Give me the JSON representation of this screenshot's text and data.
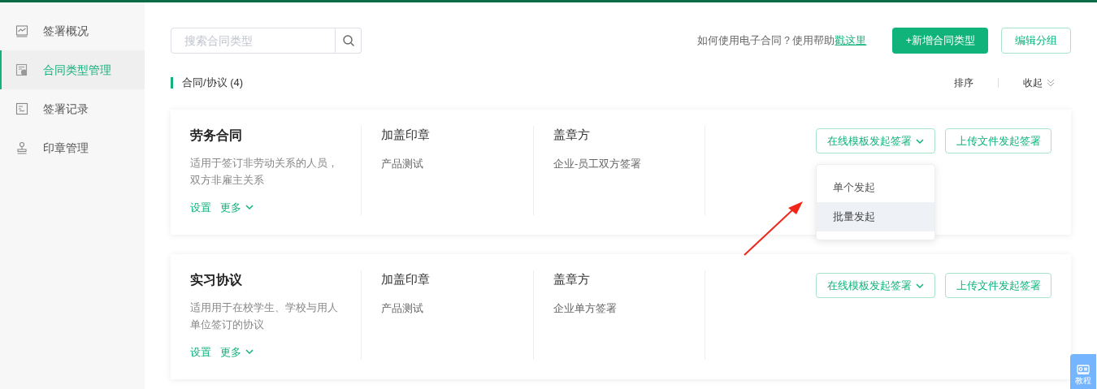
{
  "sidebar": {
    "items": [
      {
        "label": "签署概况",
        "selected": false
      },
      {
        "label": "合同类型管理",
        "selected": true
      },
      {
        "label": "签署记录",
        "selected": false
      },
      {
        "label": "印章管理",
        "selected": false
      }
    ]
  },
  "search": {
    "placeholder": "搜索合同类型"
  },
  "help": {
    "text": "如何使用电子合同？使用帮助",
    "link": "戳这里"
  },
  "buttons": {
    "add": "+新增合同类型",
    "edit": "编辑分组"
  },
  "group": {
    "title": "合同/协议 (4)",
    "sort": "排序",
    "collapse": "收起"
  },
  "cards": [
    {
      "name": "劳务合同",
      "desc": "适用于签订非劳动关系的人员，双方非雇主关系",
      "settings": "设置",
      "more": "更多",
      "col2_title": "加盖印章",
      "col2_value": "产品测试",
      "col3_title": "盖章方",
      "col3_value": "企业-员工双方签署",
      "online": "在线模板发起签署",
      "upload": "上传文件发起签署",
      "menu_open": true,
      "menu": [
        {
          "label": "单个发起",
          "selected": false
        },
        {
          "label": "批量发起",
          "selected": true
        }
      ]
    },
    {
      "name": "实习协议",
      "desc": "适用用于在校学生、学校与用人单位签订的协议",
      "settings": "设置",
      "more": "更多",
      "col2_title": "加盖印章",
      "col2_value": "产品测试",
      "col3_title": "盖章方",
      "col3_value": "企业单方签署",
      "online": "在线模板发起签署",
      "upload": "上传文件发起签署",
      "menu_open": false
    }
  ],
  "tutorial": {
    "label": "教程"
  }
}
